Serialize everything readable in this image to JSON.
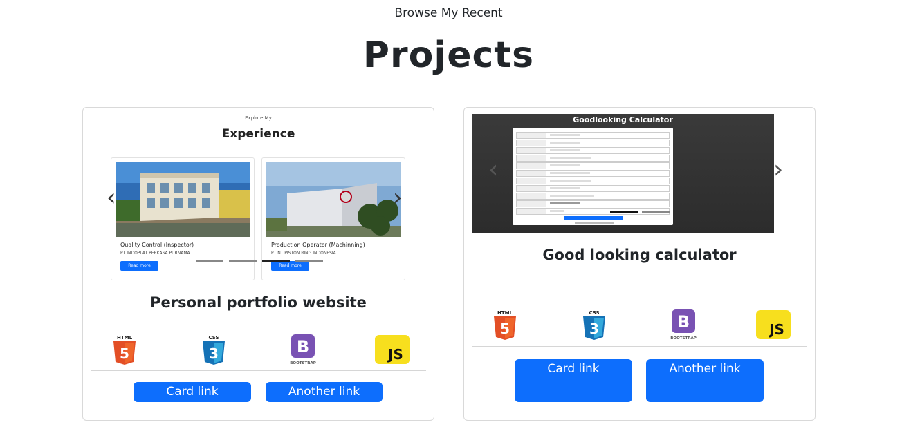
{
  "header": {
    "subtitle": "Browse My Recent",
    "title": "Projects"
  },
  "projects": [
    {
      "title": "Personal portfolio website",
      "preview": {
        "small_text": "Explore My",
        "heading": "Experience",
        "items": [
          {
            "title": "Quality Control (Inspector)",
            "subtitle": "PT INDOPLAT PERKASA PURNAMA",
            "button": "Read more"
          },
          {
            "title": "Production Operator (Machinning)",
            "subtitle": "PT NT PISTON RING INDONESIA",
            "button": "Read more"
          }
        ]
      },
      "tech": [
        "HTML",
        "CSS",
        "BOOTSTRAP",
        "JS"
      ],
      "links": [
        "Card link",
        "Another link"
      ]
    },
    {
      "title": "Good looking calculator",
      "preview": {
        "heading": "Goodlooking Calculator"
      },
      "tech": [
        "HTML",
        "CSS",
        "BOOTSTRAP",
        "JS"
      ],
      "links": [
        "Card link",
        "Another link"
      ]
    }
  ],
  "icons": {
    "html": "html5-icon",
    "css": "css3-icon",
    "bootstrap": "bootstrap-icon",
    "js": "javascript-icon",
    "prev": "chevron-left-icon",
    "next": "chevron-right-icon"
  },
  "colors": {
    "primary": "#0d6efd",
    "html": "#e34f26",
    "css": "#1572b6",
    "bootstrap": "#7952b3",
    "js": "#f7df1e"
  }
}
